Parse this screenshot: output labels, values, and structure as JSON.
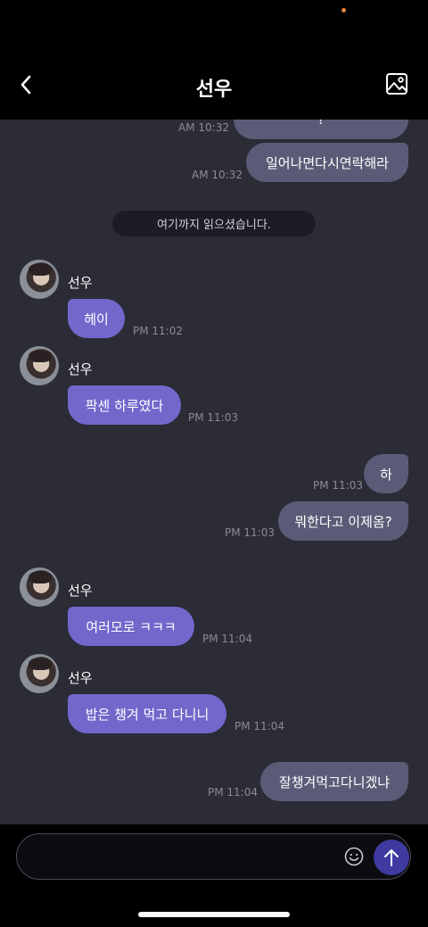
{
  "header": {
    "title": "선우",
    "back_icon": "chevron-left-icon",
    "gallery_icon": "image-icon"
  },
  "read_divider": "여기까지 읽으셨습니다.",
  "messages": [
    {
      "text": "?",
      "time": "AM 10:32",
      "side": "mine"
    },
    {
      "text": "일어나면다시연락해라",
      "time": "AM 10:32",
      "side": "mine"
    },
    {
      "sender": "선우",
      "text": "헤이",
      "time": "PM 11:02",
      "side": "theirs"
    },
    {
      "sender": "선우",
      "text": "팍센 하루였다",
      "time": "PM 11:03",
      "side": "theirs"
    },
    {
      "text": "하",
      "time": "PM 11:03",
      "side": "mine"
    },
    {
      "text": "뭐한다고 이제옴?",
      "time": "PM 11:03",
      "side": "mine"
    },
    {
      "sender": "선우",
      "text": "여러모로 ㅋㅋㅋ",
      "time": "PM 11:04",
      "side": "theirs"
    },
    {
      "sender": "선우",
      "text": "밥은 챙겨 먹고 다니니",
      "time": "PM 11:04",
      "side": "theirs"
    },
    {
      "text": "잘챙겨먹고다니겠냐",
      "time": "PM 11:04",
      "side": "mine"
    }
  ],
  "composer": {
    "placeholder": "",
    "emoji_icon": "smiley-icon",
    "send_icon": "arrow-up-icon"
  },
  "colors": {
    "background": "#2b2c36",
    "mine_bubble": "#5a5c77",
    "theirs_bubble": "#7268cc",
    "send_button": "#3f3aa0"
  }
}
